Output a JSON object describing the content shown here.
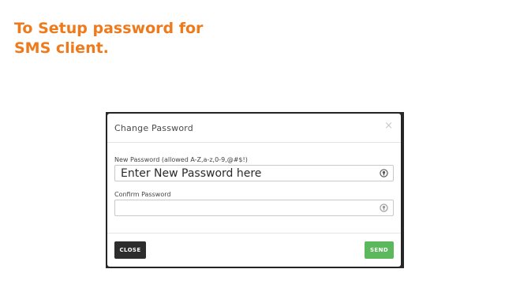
{
  "slide": {
    "title_line1": "To Setup password for",
    "title_line2": "SMS client."
  },
  "modal": {
    "title": "Change Password",
    "close_symbol": "×",
    "new_password": {
      "label": "New Password (allowed A-Z,a-z,0-9,@#$!)",
      "value": "Enter New Password here",
      "icon": "key-icon"
    },
    "confirm_password": {
      "label": "Confirm Password",
      "value": "",
      "icon": "key-icon"
    },
    "buttons": {
      "close_label": "CLOSE",
      "send_label": "SEND"
    }
  },
  "colors": {
    "title_orange": "#ee7a1c",
    "close_button": "#2d2d2d",
    "send_button": "#5cb85c"
  }
}
